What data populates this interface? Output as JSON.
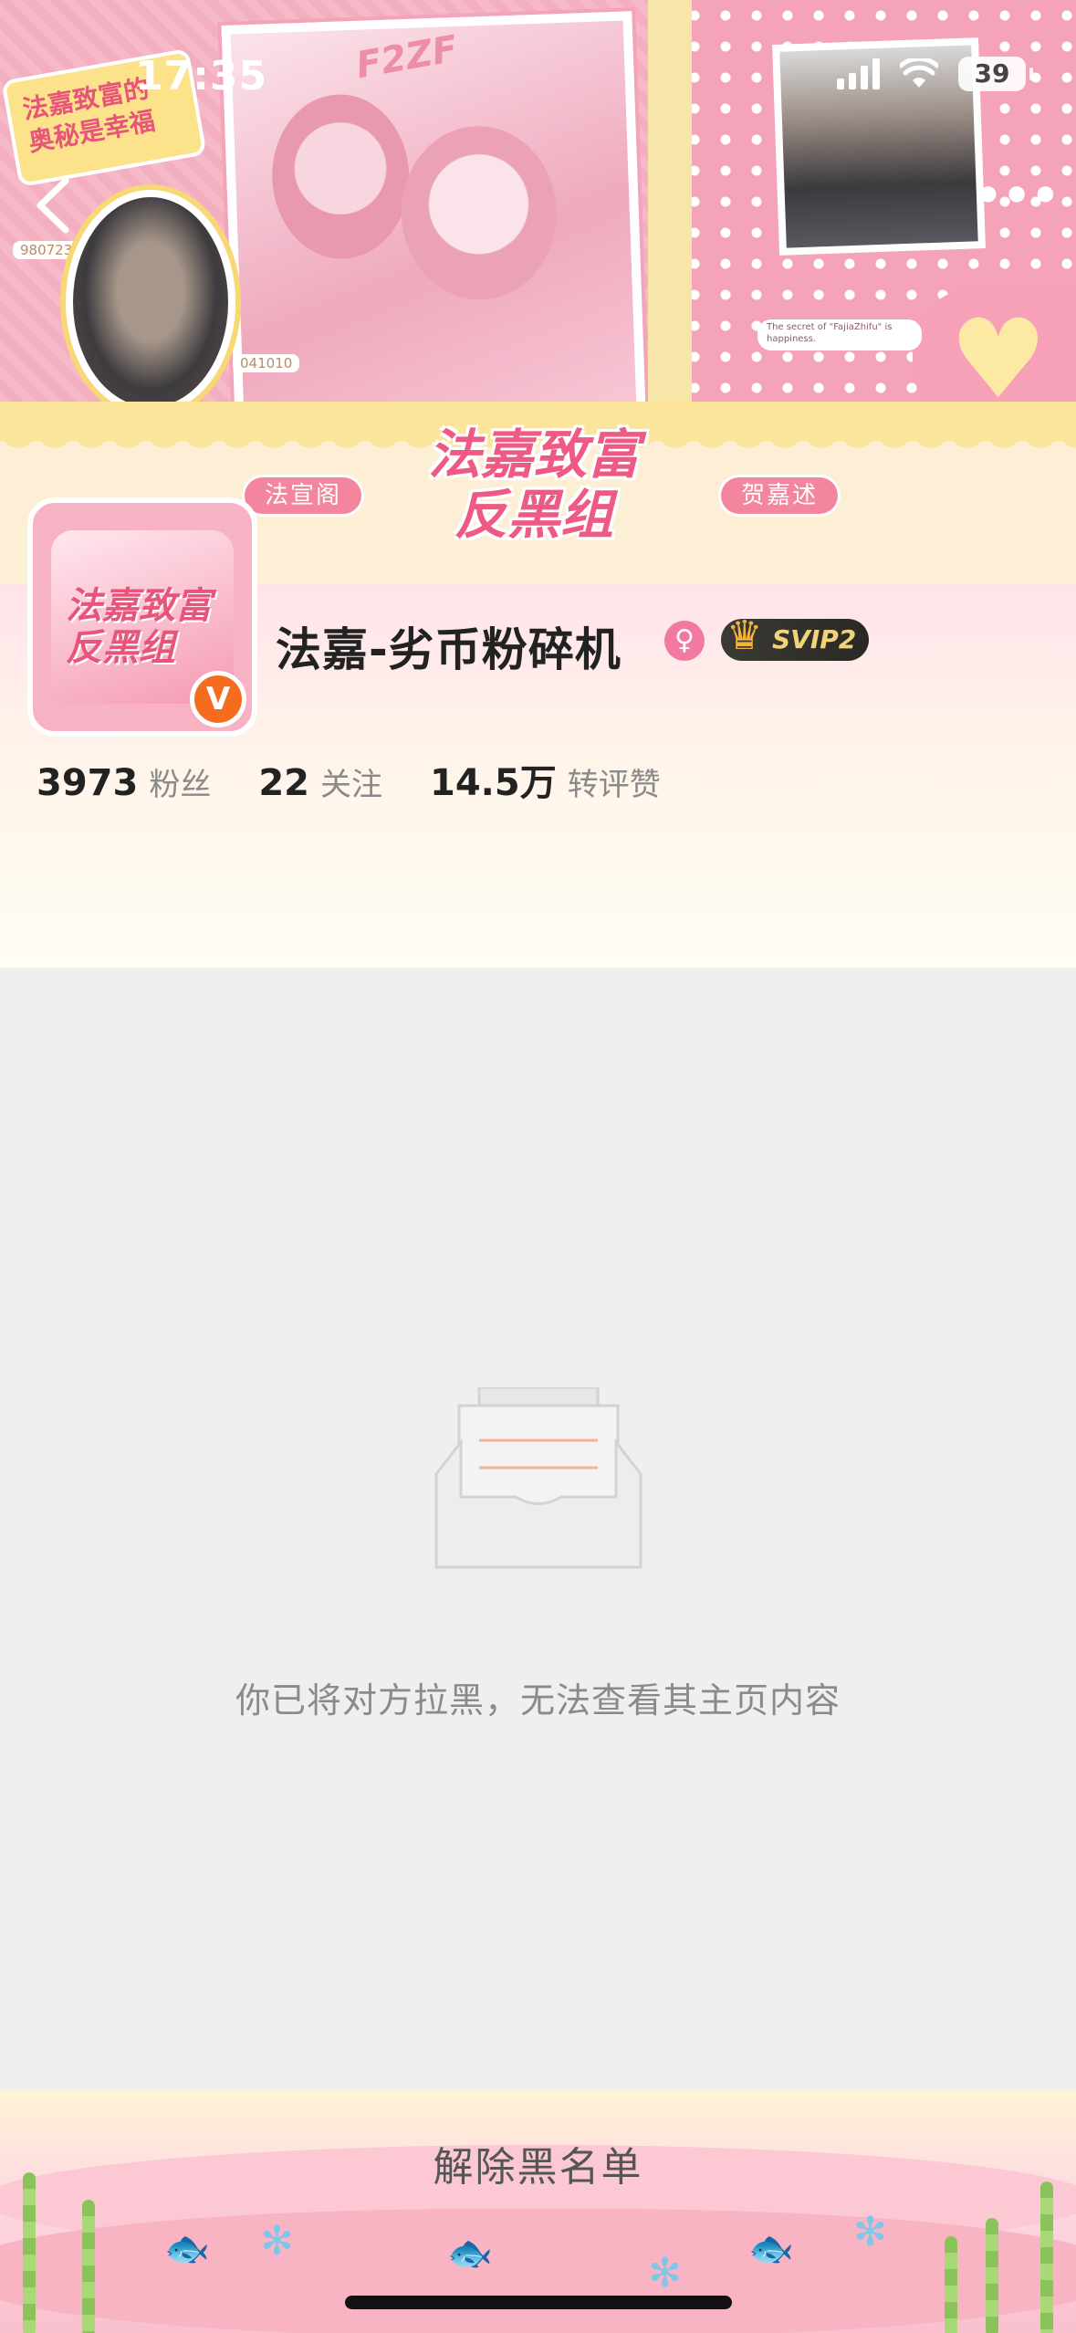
{
  "status_bar": {
    "time": "17:35",
    "battery": "39"
  },
  "banner": {
    "sticker_text": "法嘉致富的\n奥秘是幸福",
    "tag_left": "980723",
    "tag_mid": "041010",
    "handwriting": "F2ZF",
    "caption_en": "The secret of \"FajiaZhifu\" is happiness.",
    "title": "法嘉致富\n反黑组",
    "pill_left": "法宣阁",
    "pill_right": "贺嘉述"
  },
  "avatar": {
    "text": "法嘉致富\n反黑组",
    "verified_label": "V"
  },
  "profile": {
    "username": "法嘉-劣币粉碎机",
    "gender_symbol": "♀",
    "vip_badge": "SVIP2",
    "stats": [
      {
        "value": "3973",
        "label": "粉丝"
      },
      {
        "value": "22",
        "label": "关注"
      },
      {
        "value": "14.5万",
        "label": "转评赞"
      }
    ]
  },
  "blocked": {
    "message": "你已将对方拉黑，无法查看其主页内容"
  },
  "bottom": {
    "unblock_label": "解除黑名单"
  },
  "colors": {
    "accent_pink": "#f4859f",
    "verified_orange": "#f56c1e",
    "vip_gold": "#f2d37a"
  }
}
